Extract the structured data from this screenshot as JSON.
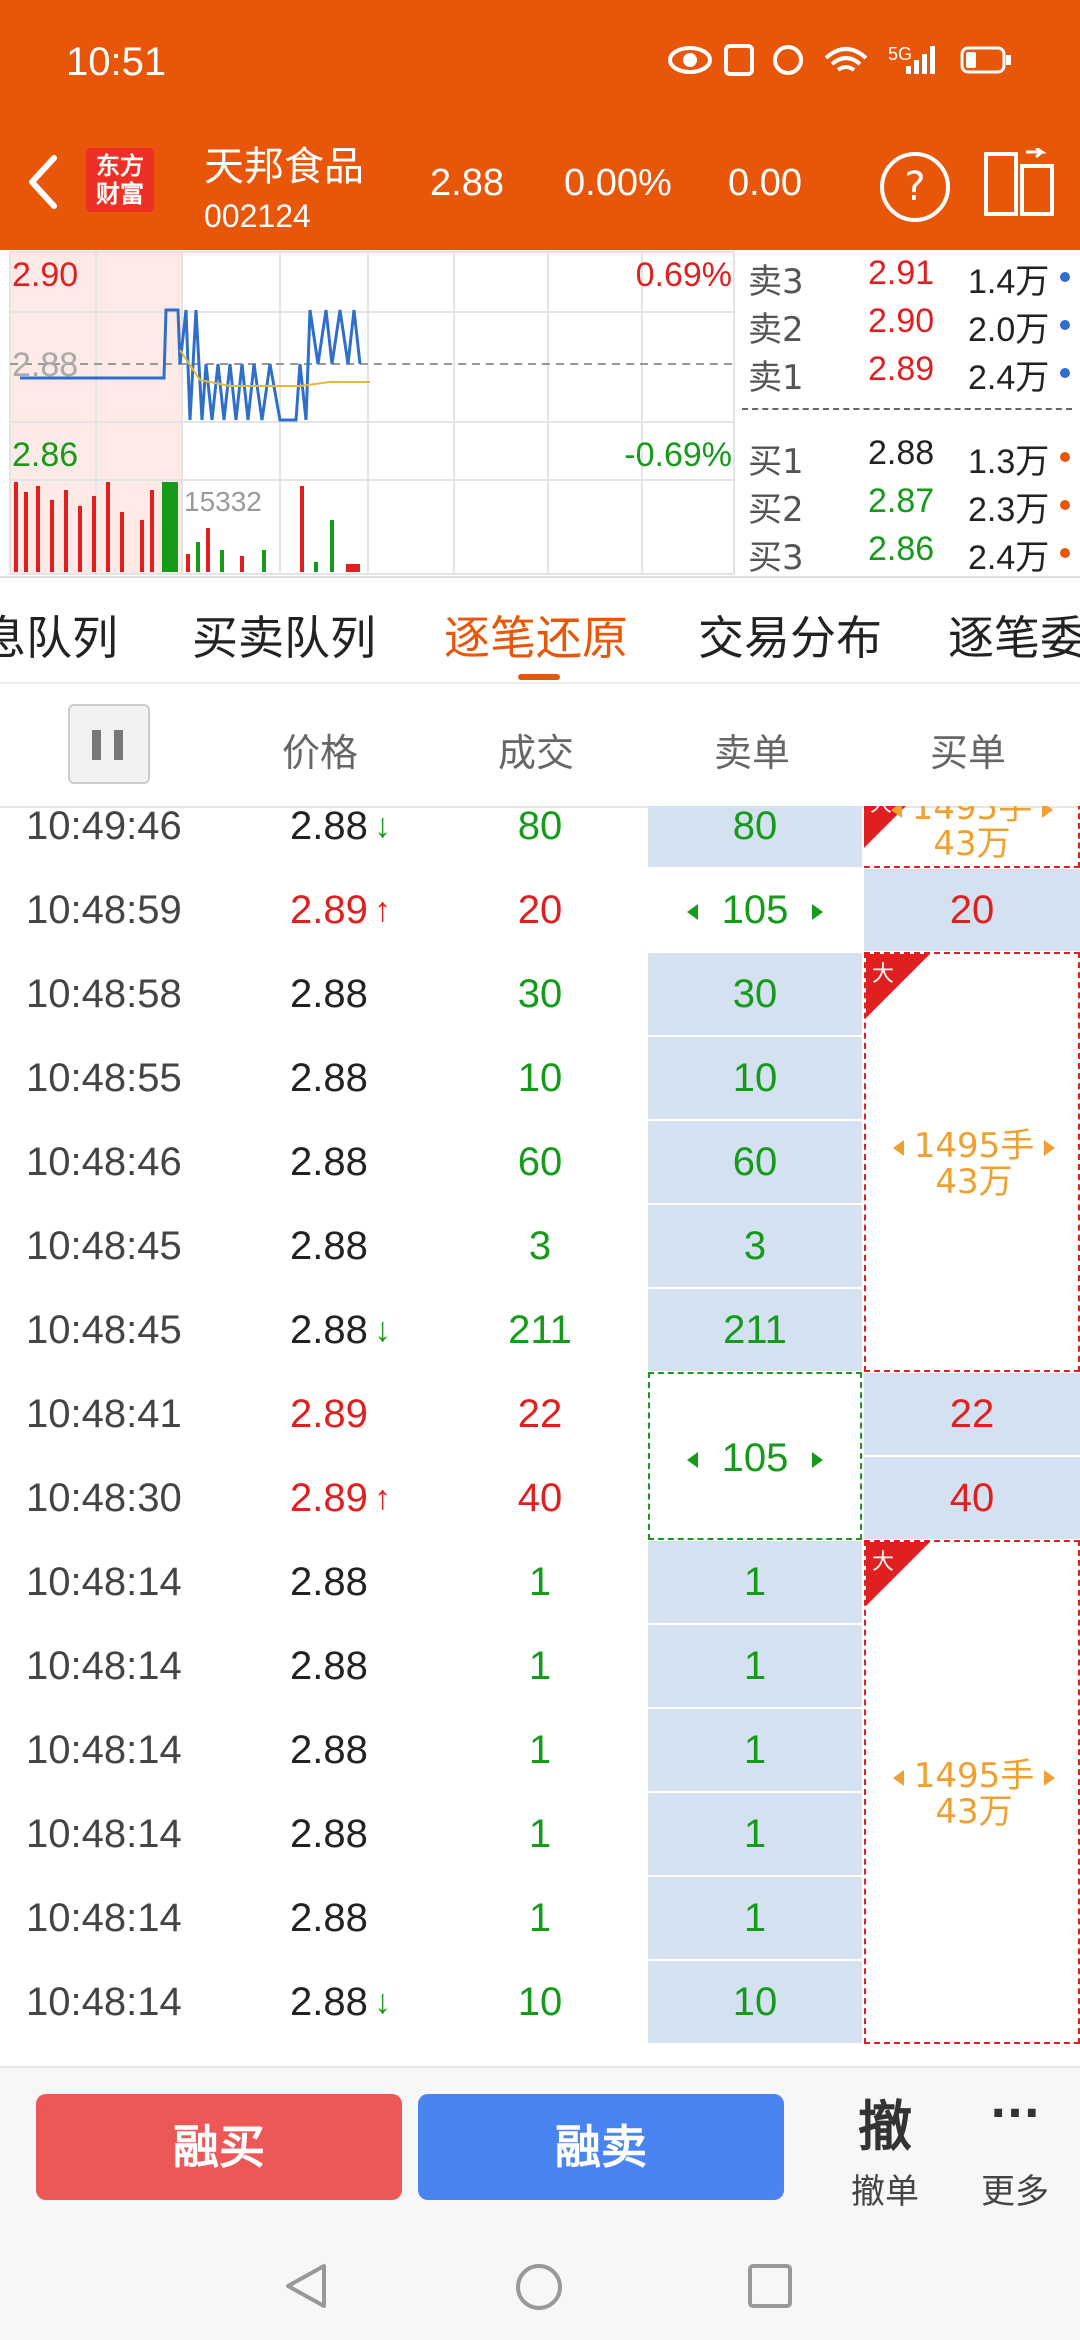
{
  "status": {
    "time": "10:51",
    "network": "5G"
  },
  "header": {
    "logo": [
      "东方",
      "财富"
    ],
    "stock_name": "天邦食品",
    "stock_code": "002124",
    "price": "2.88",
    "change_pct": "0.00%",
    "change": "0.00",
    "help_label": "?"
  },
  "chart": {
    "price_top": "2.90",
    "price_mid": "2.88",
    "price_bottom": "2.86",
    "pct_top": "0.69%",
    "pct_bottom": "-0.69%",
    "volume_max": "15332"
  },
  "quotes": {
    "sells": [
      {
        "label": "卖3",
        "price": "2.91",
        "vol": "1.4万"
      },
      {
        "label": "卖2",
        "price": "2.90",
        "vol": "2.0万"
      },
      {
        "label": "卖1",
        "price": "2.89",
        "vol": "2.4万"
      }
    ],
    "buys": [
      {
        "label": "买1",
        "price": "2.88",
        "vol": "1.3万"
      },
      {
        "label": "买2",
        "price": "2.87",
        "vol": "2.3万"
      },
      {
        "label": "买3",
        "price": "2.86",
        "vol": "2.4万"
      }
    ]
  },
  "tabs": [
    "息队列",
    "买卖队列",
    "逐笔还原",
    "交易分布",
    "逐笔委"
  ],
  "columns": {
    "price": "价格",
    "volume": "成交",
    "sell_order": "卖单",
    "buy_order": "买单"
  },
  "trades": [
    {
      "time": "10:49:46",
      "price": "2.88",
      "arrow": "↓",
      "vol": "80",
      "sell": "80",
      "buy": ""
    },
    {
      "time": "10:48:59",
      "price": "2.89",
      "arrow": "↑",
      "vol": "20",
      "sell": "105",
      "buy": "20"
    },
    {
      "time": "10:48:58",
      "price": "2.88",
      "arrow": "",
      "vol": "30",
      "sell": "30",
      "buy": ""
    },
    {
      "time": "10:48:55",
      "price": "2.88",
      "arrow": "",
      "vol": "10",
      "sell": "10",
      "buy": ""
    },
    {
      "time": "10:48:46",
      "price": "2.88",
      "arrow": "",
      "vol": "60",
      "sell": "60",
      "buy": ""
    },
    {
      "time": "10:48:45",
      "price": "2.88",
      "arrow": "",
      "vol": "3",
      "sell": "3",
      "buy": ""
    },
    {
      "time": "10:48:45",
      "price": "2.88",
      "arrow": "↓",
      "vol": "211",
      "sell": "211",
      "buy": ""
    },
    {
      "time": "10:48:41",
      "price": "2.89",
      "arrow": "",
      "vol": "22",
      "sell": "",
      "buy": "22"
    },
    {
      "time": "10:48:30",
      "price": "2.89",
      "arrow": "↑",
      "vol": "40",
      "sell": "",
      "buy": "40"
    },
    {
      "time": "10:48:14",
      "price": "2.88",
      "arrow": "",
      "vol": "1",
      "sell": "1",
      "buy": ""
    },
    {
      "time": "10:48:14",
      "price": "2.88",
      "arrow": "",
      "vol": "1",
      "sell": "1",
      "buy": ""
    },
    {
      "time": "10:48:14",
      "price": "2.88",
      "arrow": "",
      "vol": "1",
      "sell": "1",
      "buy": ""
    },
    {
      "time": "10:48:14",
      "price": "2.88",
      "arrow": "",
      "vol": "1",
      "sell": "1",
      "buy": ""
    },
    {
      "time": "10:48:14",
      "price": "2.88",
      "arrow": "",
      "vol": "1",
      "sell": "1",
      "buy": ""
    },
    {
      "time": "10:48:14",
      "price": "2.88",
      "arrow": "↓",
      "vol": "10",
      "sell": "10",
      "buy": ""
    }
  ],
  "big_order": {
    "flag": "大",
    "hands": "1495手",
    "amount": "43万"
  },
  "merged_sell": {
    "value": "105"
  },
  "actions": {
    "buy": "融买",
    "sell": "融卖",
    "cancel_icon": "撤",
    "cancel": "撤单",
    "more_icon": "···",
    "more": "更多"
  },
  "colors": {
    "header": "#e8560a",
    "up": "#e02020",
    "down": "#159a19",
    "buy_btn": "#ec5757",
    "sell_btn": "#4a84f0",
    "accent_orange": "#f0a030",
    "sell_cell": "#d4e1f1"
  }
}
